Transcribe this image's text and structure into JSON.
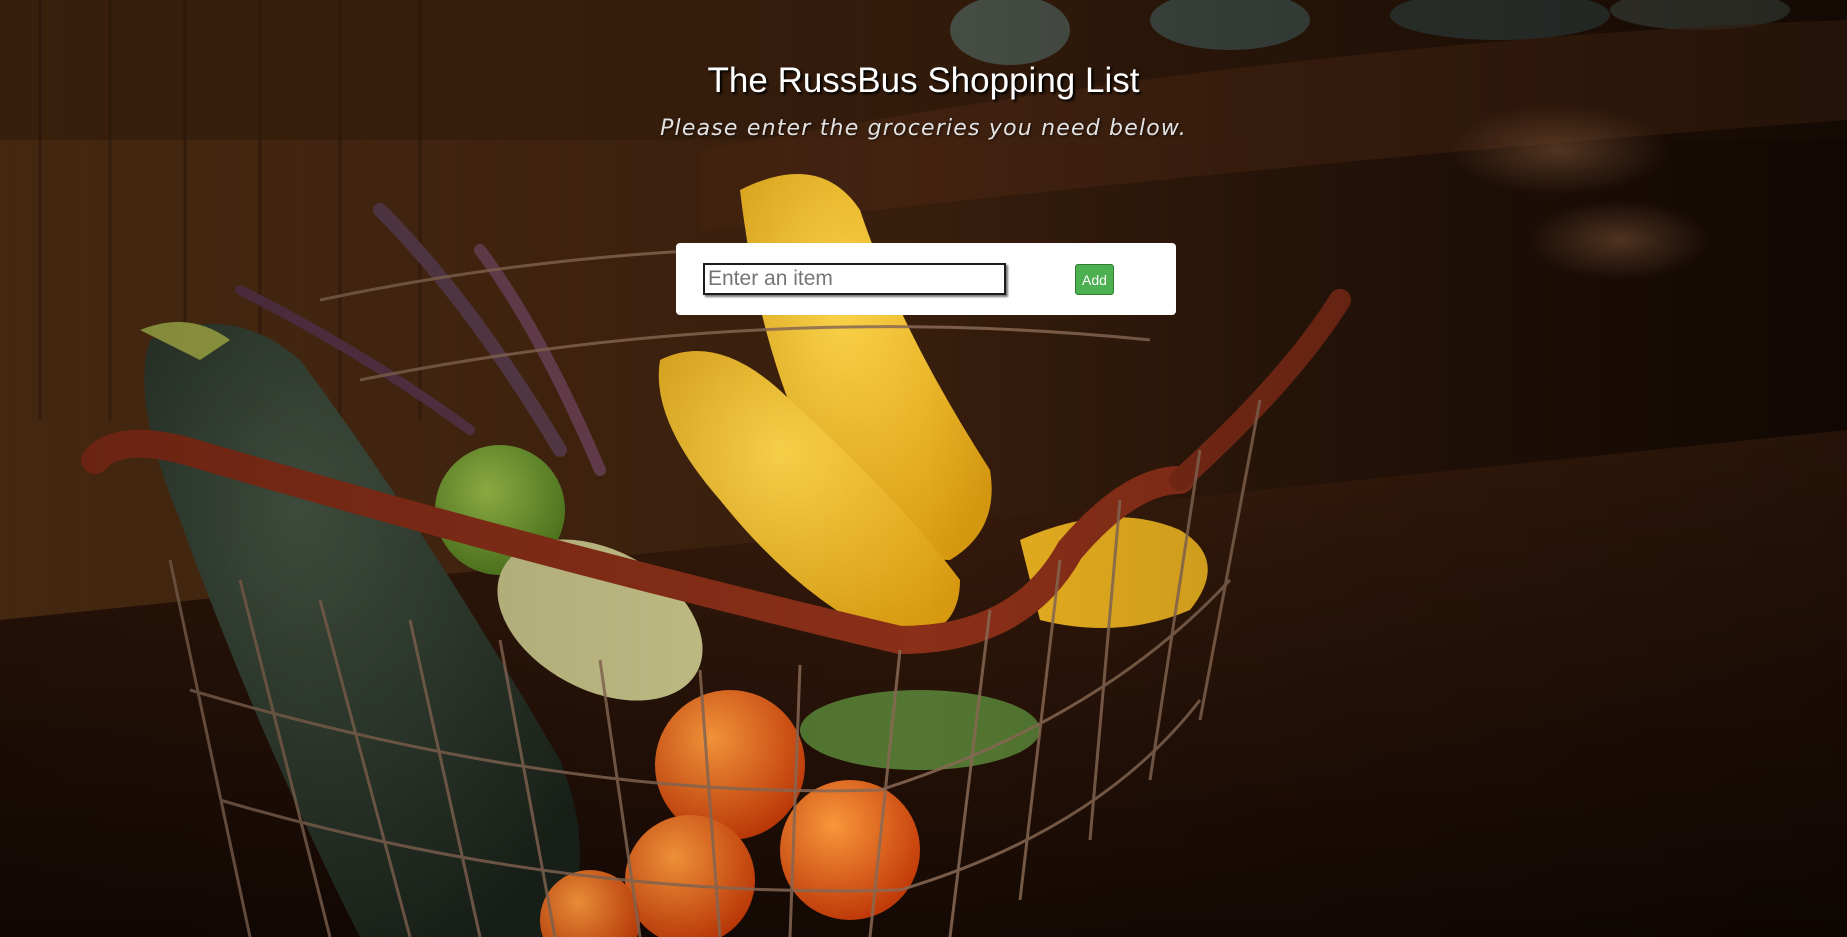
{
  "header": {
    "title": "The RussBus Shopping List",
    "subtitle": "Please enter the groceries you need below."
  },
  "form": {
    "input_placeholder": "Enter an item",
    "input_value": "",
    "add_label": "Add"
  },
  "colors": {
    "add_button": "#4caf50",
    "card_background": "#ffffff",
    "title_text": "#ffffff"
  },
  "background": {
    "subject": "wire basket of vegetables on a wooden counter"
  }
}
